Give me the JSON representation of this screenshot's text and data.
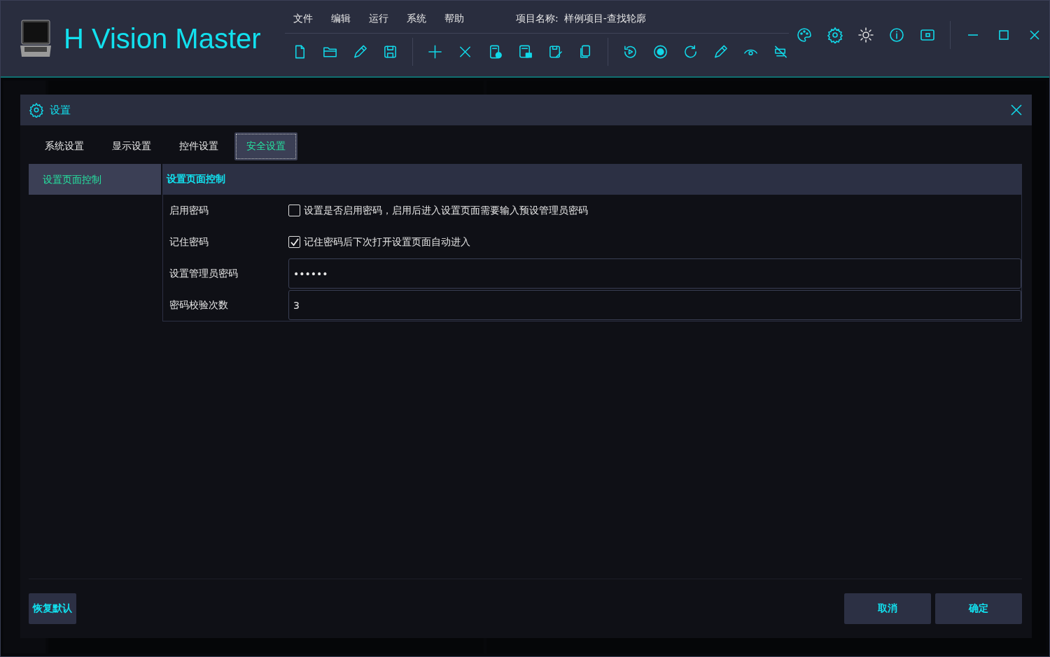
{
  "app": {
    "title": "H Vision Master",
    "menu": [
      "文件",
      "编辑",
      "运行",
      "系统",
      "帮助"
    ],
    "project_label": "项目名称:",
    "project_name": "样例项目-查找轮廓"
  },
  "dialog": {
    "title": "设置",
    "tabs": [
      {
        "label": "系统设置",
        "selected": false
      },
      {
        "label": "显示设置",
        "selected": false
      },
      {
        "label": "控件设置",
        "selected": false
      },
      {
        "label": "安全设置",
        "selected": true
      }
    ],
    "nav": [
      {
        "label": "设置页面控制",
        "selected": true
      }
    ],
    "section_title": "设置页面控制",
    "rows": [
      {
        "kind": "checkbox",
        "label": "启用密码",
        "checked": false,
        "text": "设置是否启用密码，启用后进入设置页面需要输入预设管理员密码"
      },
      {
        "kind": "checkbox",
        "label": "记住密码",
        "checked": true,
        "text": "记住密码后下次打开设置页面自动进入"
      },
      {
        "kind": "field",
        "label": "设置管理员密码",
        "value": "••••••"
      },
      {
        "kind": "field",
        "label": "密码校验次数",
        "value": "3"
      }
    ],
    "buttons": {
      "reset": "恢复默认",
      "cancel": "取消",
      "ok": "确定"
    }
  }
}
